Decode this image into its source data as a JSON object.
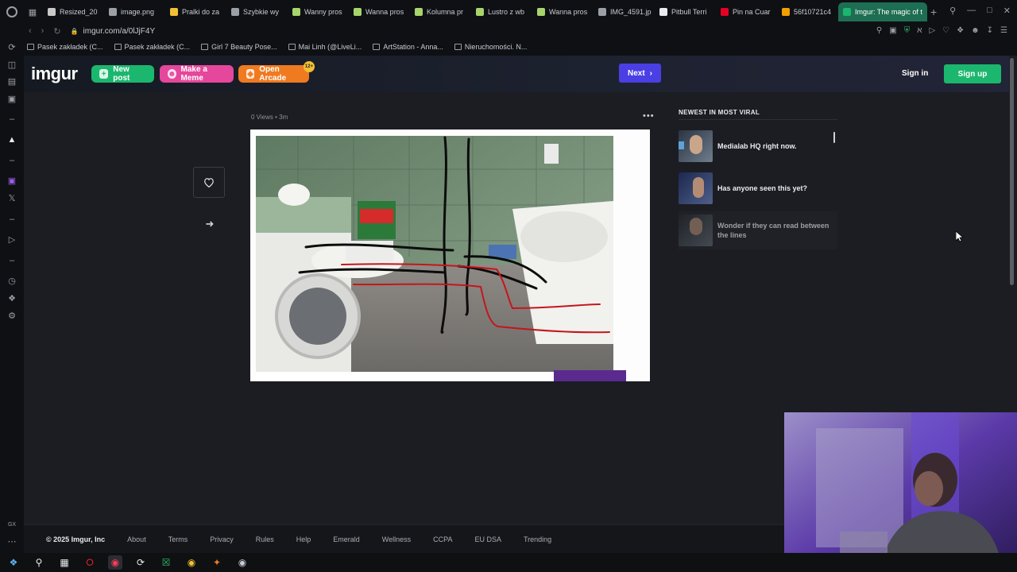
{
  "browser": {
    "tabs": [
      {
        "label": "Resized_20",
        "color": "#c9c9c9"
      },
      {
        "label": "image.png",
        "color": "#9aa0a6"
      },
      {
        "label": "Pralki do za",
        "color": "#f2c033"
      },
      {
        "label": "Szybkie wy",
        "color": "#9aa0a6"
      },
      {
        "label": "Wanny pros",
        "color": "#a7d46b"
      },
      {
        "label": "Wanna pros",
        "color": "#a7d46b"
      },
      {
        "label": "Kolumna pr",
        "color": "#a7d46b"
      },
      {
        "label": "Lustro z wb",
        "color": "#a7d46b"
      },
      {
        "label": "Wanna pros",
        "color": "#a7d46b"
      },
      {
        "label": "IMG_4591.jp",
        "color": "#9aa0a6"
      },
      {
        "label": "Pitbull Terri",
        "color": "#e8ebef"
      },
      {
        "label": "Pin na Cuar",
        "color": "#e60023"
      },
      {
        "label": "56f10721c4",
        "color": "#f2a100"
      }
    ],
    "active_tab": "Imgur: The magic of t",
    "url": "imgur.com/a/0lJjF4Y",
    "bookmarks": [
      "Pasek zakładek (C...",
      "Pasek zakładek (C...",
      "Girl 7 Beauty Pose...",
      "Mai Linh (@LiveLi...",
      "ArtStation - Anna...",
      "Nieruchomości. N..."
    ]
  },
  "header": {
    "logo": "imgur",
    "new_post": "New post",
    "make_meme": "Make a Meme",
    "open_arcade": "Open Arcade",
    "arcade_badge": "12+",
    "next": "Next",
    "sign_in": "Sign in",
    "sign_up": "Sign up"
  },
  "post": {
    "views": "0 Views",
    "age": "3m",
    "menu_glyph": "•••"
  },
  "viral": {
    "title": "NEWEST IN MOST VIRAL",
    "items": [
      {
        "title": "Medialab HQ right now."
      },
      {
        "title": "Has anyone seen this yet?"
      },
      {
        "title": "Wonder if they can read between the lines"
      }
    ]
  },
  "footer": {
    "copyright": "© 2025 Imgur, Inc",
    "links": [
      "About",
      "Terms",
      "Privacy",
      "Rules",
      "Help",
      "Emerald",
      "Wellness",
      "CCPA",
      "EU DSA",
      "Trending"
    ]
  },
  "colors": {
    "accent_green": "#1bb76e",
    "meme_pink": "#e5479c",
    "arcade_orange": "#ef7a20",
    "next_purple": "#4a3fe4"
  }
}
